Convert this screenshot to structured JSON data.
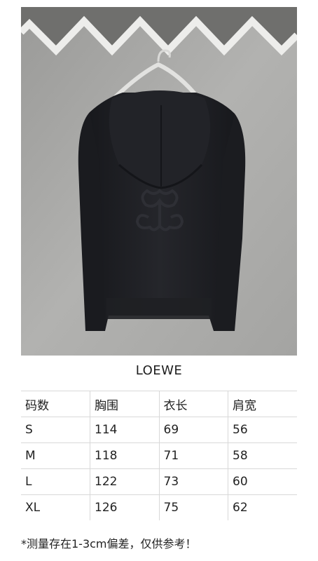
{
  "product": {
    "brand": "LOEWE",
    "image_subject": "black knit hoodie on hanger, back view with embossed anagram logo"
  },
  "size_chart": {
    "headers": [
      "码数",
      "胸围",
      "衣长",
      "肩宽"
    ],
    "rows": [
      [
        "S",
        "114",
        "69",
        "56"
      ],
      [
        "M",
        "118",
        "71",
        "58"
      ],
      [
        "L",
        "122",
        "73",
        "60"
      ],
      [
        "XL",
        "126",
        "75",
        "62"
      ]
    ]
  },
  "note": "*测量存在1-3cm偏差，仅供参考！",
  "colors": {
    "garment": "#1c1d21",
    "wall": "#a9a9a7",
    "table_border": "#d8d8d8"
  }
}
